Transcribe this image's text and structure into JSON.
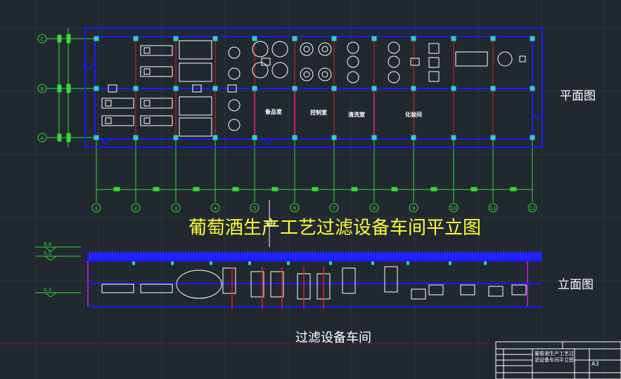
{
  "drawing": {
    "title": "葡萄酒生产工艺过滤设备车间平立图",
    "plan_label": "平面图",
    "elevation_label": "立面图",
    "subtitle": "过滤设备车间"
  },
  "plan": {
    "rooms": [
      "备品室",
      "控制室",
      "清洗室",
      "化验间"
    ],
    "column_axes": [
      "1",
      "2",
      "3",
      "4",
      "5",
      "6",
      "7",
      "8",
      "9",
      "10",
      "11",
      "12"
    ],
    "row_axes": [
      "C",
      "B",
      "A"
    ]
  },
  "elevation": {
    "levels": [
      "6.4",
      "5.3",
      "0.3"
    ]
  },
  "title_block": {
    "name": "葡萄酒生产工艺过滤设备车间平立图",
    "size": "A3"
  },
  "colors": {
    "background": "#212830",
    "wall": "#1a1aff",
    "axis": "#33dd33",
    "red": "#e02020",
    "title": "#ffff33",
    "column": "#33cccc"
  }
}
